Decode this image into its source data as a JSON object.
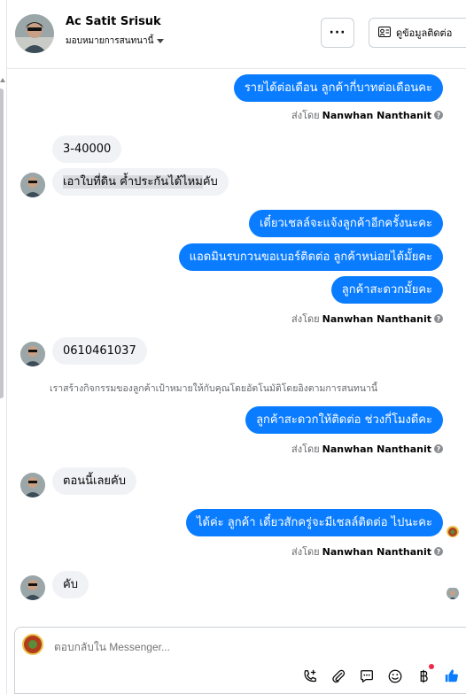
{
  "header": {
    "contact_name": "Ac Satit Srisuk",
    "assign_label": "มอบหมายการสนทนานี้",
    "more_label": "···",
    "contact_info_label": "ดูข้อมูลติดต่อ"
  },
  "messages": [
    {
      "text": "รายได้ต่อเดือน ลูกค้ากี่บาทต่อเดือนคะ",
      "dir": "out"
    },
    {
      "text": "3-40000",
      "dir": "in"
    },
    {
      "text_a": "เอาใบที่ดิน  ค้ำประกันได้ไหม",
      "text_b": "คับ",
      "dir": "in"
    },
    {
      "text": "เดี๋ยวเชลล์จะแจ้งลูกค้าอีกครั้งนะคะ",
      "dir": "out"
    },
    {
      "text": "แอดมินรบกวนขอเบอร์ติดต่อ ลูกค้าหน่อยได้มั้ยคะ",
      "dir": "out"
    },
    {
      "text": "ลูกค้าสะดวกมั้ยคะ",
      "dir": "out"
    },
    {
      "text": "0610461037",
      "dir": "in"
    },
    {
      "text": "ลูกค้าสะดวกให้ติดต่อ ช่วงกี่โมงดีคะ",
      "dir": "out"
    },
    {
      "text": "ตอนนี้เลยคับ",
      "dir": "in"
    },
    {
      "text": "ได้ค่ะ ลูกค้า เดี๋ยวสักครู่จะมีเชลล์ติดต่อ ไปนะคะ",
      "dir": "out"
    },
    {
      "text": "คับ",
      "dir": "in"
    }
  ],
  "sent_by": {
    "prefix": "ส่งโดย",
    "name": "Nanwhan Nanthanit",
    "help": "?"
  },
  "system_note": "เราสร้างกิจกรรมของลูกค้าเป้าหมายให้กับคุณโดยอัตโนมัติโดยอิงตามการสนทนานี้",
  "composer": {
    "placeholder": "ตอบกลับใน Messenger...",
    "icons": [
      "phone-plus-icon",
      "paperclip-icon",
      "saved-reply-icon",
      "emoji-icon",
      "baht-payment-icon",
      "like-icon"
    ]
  },
  "colors": {
    "outgoing_bubble": "#0a7cff",
    "incoming_bubble": "#f0f2f5",
    "like_blue": "#0a7cff"
  }
}
